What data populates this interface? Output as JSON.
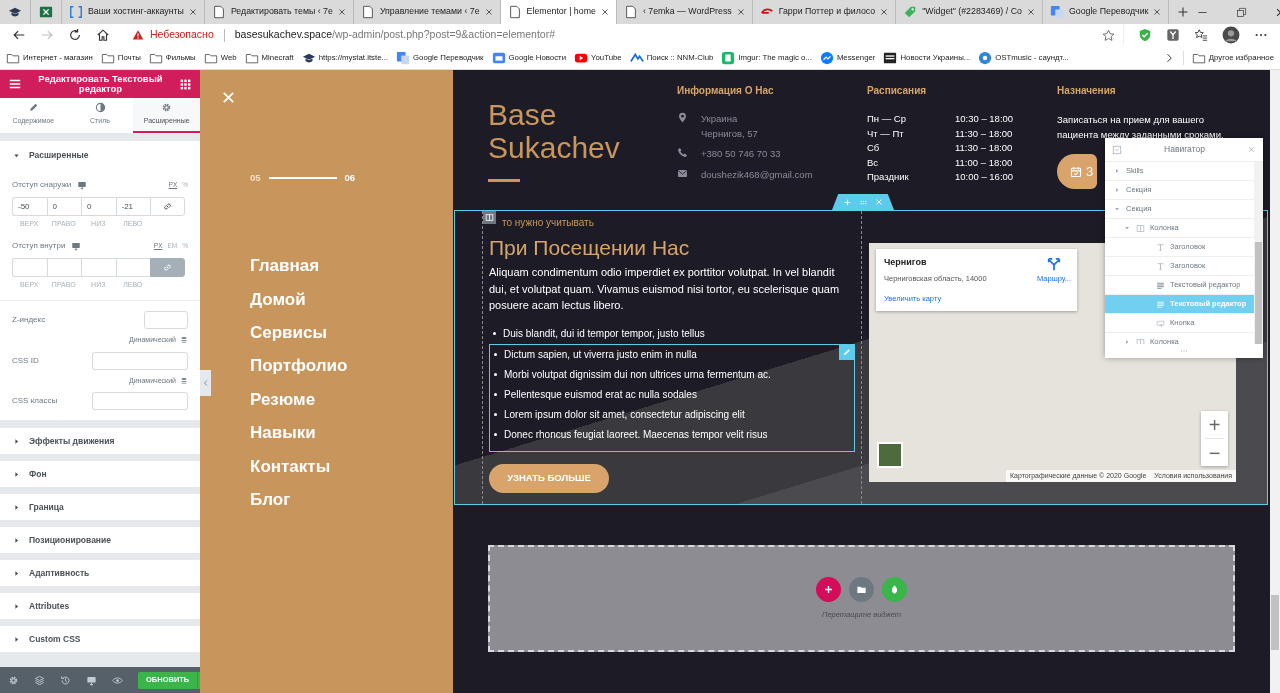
{
  "browser": {
    "tabs": [
      {
        "kind": "cap",
        "selected": false
      },
      {
        "kind": "excel",
        "selected": false
      },
      {
        "kind": "bracket",
        "title": "Ваши хостинг-аккаунты",
        "selected": false
      },
      {
        "kind": "page",
        "title": "Редактировать темы ‹ 7e",
        "selected": false
      },
      {
        "kind": "page",
        "title": "Управление темами ‹ 7e",
        "selected": false
      },
      {
        "kind": "page",
        "title": "Elementor | home",
        "selected": true
      },
      {
        "kind": "page",
        "title": "‹ 7emka — WordPress",
        "selected": false
      },
      {
        "kind": "redarrow",
        "title": "Гарри Поттер и филосо",
        "selected": false
      },
      {
        "kind": "tag",
        "title": "\"Widget\" (#2283469) / Co",
        "selected": false
      },
      {
        "kind": "translate",
        "title": "Google Переводчик",
        "selected": false
      }
    ],
    "forward_disabled": true,
    "security": "Небезопасно",
    "url_host": "basesukachev.space",
    "url_path": "/wp-admin/post.php?post=9&action=elementor#",
    "bookmarks": [
      {
        "kind": "folder",
        "label": "Интернет - магазин"
      },
      {
        "kind": "folder",
        "label": "Почты"
      },
      {
        "kind": "folder",
        "label": "Фильмы"
      },
      {
        "kind": "folder",
        "label": "Web"
      },
      {
        "kind": "folder",
        "label": "Minecraft"
      },
      {
        "kind": "cap",
        "label": "https://mystat.itste..."
      },
      {
        "kind": "translate",
        "label": "Google Переводчик"
      },
      {
        "kind": "news",
        "label": "Google Новости"
      },
      {
        "kind": "youtube",
        "label": "YouTube"
      },
      {
        "kind": "nnm",
        "label": "Поиск :: NNM-Club"
      },
      {
        "kind": "imgur",
        "label": "Imgur: The magic o..."
      },
      {
        "kind": "messenger",
        "label": "Messenger"
      },
      {
        "kind": "news2",
        "label": "Новости Украины..."
      },
      {
        "kind": "ost",
        "label": "OSTmusic - саундт..."
      }
    ],
    "other_bookmarks": "Другое избранное"
  },
  "editor_panel": {
    "title": "Редактировать Текстовый редактор",
    "tabs": [
      {
        "label": "Содержимое",
        "kind": "pencil",
        "selected": false
      },
      {
        "label": "Стиль",
        "kind": "contrast",
        "selected": false
      },
      {
        "label": "Расширенные",
        "kind": "gear",
        "selected": true
      }
    ],
    "section": {
      "title": "Расширенные",
      "expanded": true
    },
    "margin": {
      "label": "Отступ снаружи",
      "units": [
        {
          "label": "PX",
          "selected": true
        },
        {
          "label": "%",
          "selected": false
        }
      ],
      "values": [
        "-50",
        "0",
        "0",
        "-21"
      ],
      "sides": [
        "ВЕРХ",
        "ПРАВО",
        "НИЗ",
        "ЛЕВО"
      ],
      "linked": false
    },
    "padding": {
      "label": "Отступ внутри",
      "units": [
        {
          "label": "PX",
          "selected": true
        },
        {
          "label": "EM",
          "selected": false
        },
        {
          "label": "%",
          "selected": false
        }
      ],
      "sides": [
        "ВЕРХ",
        "ПРАВО",
        "НИЗ",
        "ЛЕВО"
      ],
      "linked": true
    },
    "z_index": {
      "label": "Z-индекс"
    },
    "css_id": {
      "dynamic": "Динамический",
      "label": "CSS ID"
    },
    "css_classes": {
      "dynamic": "Динамический",
      "label": "CSS классы"
    },
    "sections": [
      {
        "title": "Эффекты движения",
        "expanded": false
      },
      {
        "title": "Фон",
        "expanded": false
      },
      {
        "title": "Граница",
        "expanded": false
      },
      {
        "title": "Позиционирование",
        "expanded": false
      },
      {
        "title": "Адаптивность",
        "expanded": false
      },
      {
        "title": "Attributes",
        "expanded": false
      },
      {
        "title": "Custom CSS",
        "expanded": false
      }
    ],
    "update_button": "ОБНОВИТЬ"
  },
  "side_menu": {
    "pager_current": "05",
    "pager_next": "06",
    "items": [
      "Главная",
      "Домой",
      "Сервисы",
      "Портфолио",
      "Резюме",
      "Навыки",
      "Контакты",
      "Блог"
    ]
  },
  "site_header": {
    "logo": "Base Sukachev",
    "info": {
      "title": "Информация О Нас",
      "items": [
        {
          "kind": "pin",
          "lines": [
            "Украина",
            "Чернигов, 57"
          ]
        },
        {
          "kind": "phone",
          "lines": [
            "+380 50 746 70 33"
          ]
        },
        {
          "kind": "mail",
          "lines": [
            "doushezik468@gmail.com"
          ]
        }
      ]
    },
    "schedule": {
      "title": "Расписания",
      "rows": [
        {
          "day": "Пн — Ср",
          "hours": "10:30 – 18:00"
        },
        {
          "day": "Чт — Пт",
          "hours": "11:30 – 18:00"
        },
        {
          "day": "Сб",
          "hours": "11:30 – 18:00"
        },
        {
          "day": "Вс",
          "hours": "11:00 – 18:00"
        },
        {
          "day": "Праздник",
          "hours": "10:00 – 16:00"
        }
      ]
    },
    "appointment": {
      "title": "Назначения",
      "text": "Записаться на прием для вашего пациента между заданными сроками.",
      "button": "З"
    }
  },
  "section": {
    "subtitle": "то нужно учитывать",
    "heading": "При Посещении Нас",
    "paragraph": "Aliquam condimentum odio imperdiet ex porttitor volutpat. In vel blandit dui, et volutpat quam. Vivamus euismod nisi tortor, eu scelerisque quam posuere acam lectus libero.",
    "list_items": [
      {
        "text": "Duis blandit, dui id tempor tempor, justo tellus",
        "in_selected_widget": false
      },
      {
        "text": "Dictum sapien, ut viverra justo enim in nulla",
        "in_selected_widget": true
      },
      {
        "text": "Morbi volutpat dignissim dui non ultrices urna fermentum ac.",
        "in_selected_widget": true
      },
      {
        "text": "Pellentesque euismod erat ac nulla sodales",
        "in_selected_widget": true
      },
      {
        "text": "Lorem ipsum dolor sit amet, consectetur adipiscing elit",
        "in_selected_widget": true
      },
      {
        "text": "Donec rhoncus feugiat laoreet. Maecenas tempor velit risus",
        "in_selected_widget": true
      }
    ],
    "button": "УЗНАТЬ БОЛЬШЕ",
    "map": {
      "place": "Чернигов",
      "region": "Черниговская область, 14000",
      "directions": "Маршру...",
      "larger_map": "Увеличить карту",
      "zoom_in": "+",
      "zoom_out": "−",
      "attribution": "Картографические данные © 2020 Google",
      "terms": "Условия использования"
    }
  },
  "dropzone": {
    "hint": "Перетащите виджет"
  },
  "navigator": {
    "title": "Навигатор",
    "tree": [
      {
        "label": "Skills",
        "expanded": false,
        "selected": false
      },
      {
        "label": "Секция",
        "expanded": false,
        "selected": false
      },
      {
        "label": "Секция",
        "expanded": true,
        "selected": false,
        "children": [
          {
            "kind": "column",
            "label": "Колонка",
            "expanded": true,
            "selected": false,
            "children": [
              {
                "kind": "heading",
                "label": "Заголовок",
                "selected": false
              },
              {
                "kind": "heading",
                "label": "Заголовок",
                "selected": false
              },
              {
                "kind": "text",
                "label": "Текстовый редактор",
                "selected": false
              },
              {
                "kind": "text",
                "label": "Текстовый редактор",
                "selected": true
              },
              {
                "kind": "button",
                "label": "Кнопка",
                "selected": false
              }
            ]
          },
          {
            "kind": "column",
            "label": "Колонка",
            "expanded": false,
            "selected": false
          }
        ]
      }
    ]
  }
}
